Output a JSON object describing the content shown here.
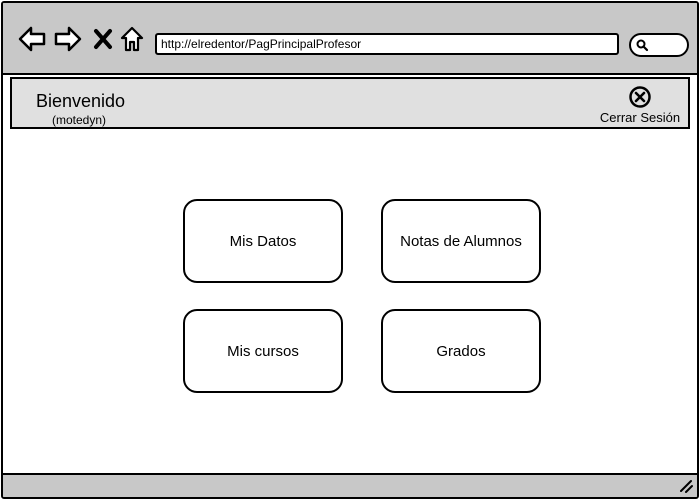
{
  "browser": {
    "url": "http://elredentor/PagPrincipalProfesor",
    "icons": [
      "back-arrow-icon",
      "forward-arrow-icon",
      "close-icon",
      "home-icon",
      "search-icon"
    ]
  },
  "header": {
    "welcome": "Bienvenido",
    "username": "(motedyn)",
    "logout_label": "Cerrar Sesión",
    "logout_icon": "close-circle-icon"
  },
  "menu": {
    "buttons": [
      {
        "label": "Mis Datos"
      },
      {
        "label": "Notas de Alumnos"
      },
      {
        "label": "Mis cursos"
      },
      {
        "label": "Grados"
      }
    ]
  },
  "colors": {
    "chrome": "#c8c8c8",
    "header_bg": "#e0e0e0"
  }
}
